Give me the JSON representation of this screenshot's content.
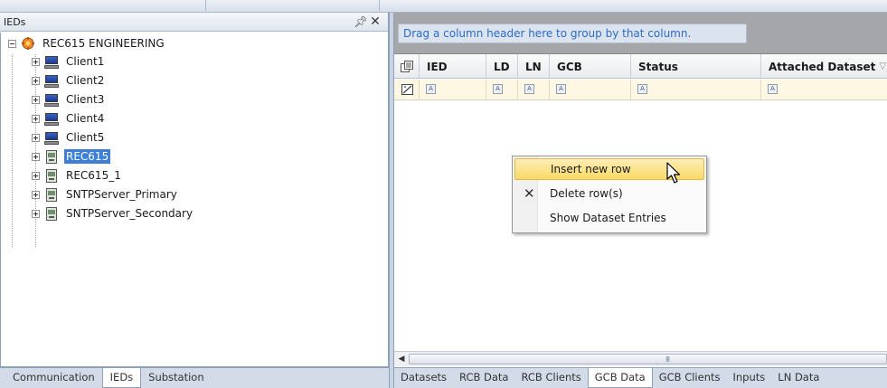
{
  "left_panel": {
    "title": "IEDs",
    "pin_icon": "↕",
    "close_icon": "✕",
    "tree": {
      "root": "REC615 ENGINEERING",
      "children": [
        {
          "label": "Client1",
          "icon": "client-computer-icon"
        },
        {
          "label": "Client2",
          "icon": "client-computer-icon"
        },
        {
          "label": "Client3",
          "icon": "client-computer-icon"
        },
        {
          "label": "Client4",
          "icon": "client-computer-icon"
        },
        {
          "label": "Client5",
          "icon": "client-computer-icon"
        },
        {
          "label": "REC615",
          "icon": "ied-device-icon",
          "selected": true
        },
        {
          "label": "REC615_1",
          "icon": "ied-device-icon"
        },
        {
          "label": "SNTPServer_Primary",
          "icon": "ied-device-icon"
        },
        {
          "label": "SNTPServer_Secondary",
          "icon": "ied-device-icon"
        }
      ]
    },
    "tabs": [
      "Communication",
      "IEDs",
      "Substation"
    ],
    "active_tab": "IEDs"
  },
  "right_panel": {
    "group_hint": "Drag a column header here to group by that column.",
    "columns": [
      "IED",
      "LD",
      "LN",
      "GCB",
      "Status",
      "Attached Dataset"
    ],
    "filter_glyph": "A",
    "scroll_grip": "III",
    "tabs": [
      "Datasets",
      "RCB Data",
      "RCB Clients",
      "GCB Data",
      "GCB Clients",
      "Inputs",
      "LN Data"
    ],
    "active_tab": "GCB Data"
  },
  "context_menu": {
    "items": [
      {
        "label": "Insert new row",
        "highlighted": true
      },
      {
        "label": "Delete row(s)",
        "icon": "delete-x-icon"
      },
      {
        "label": "Show Dataset Entries"
      }
    ]
  },
  "colors": {
    "selection": "#3d7fd6",
    "hint_text": "#2b6cc4",
    "menu_highlight": "#f9d966"
  }
}
